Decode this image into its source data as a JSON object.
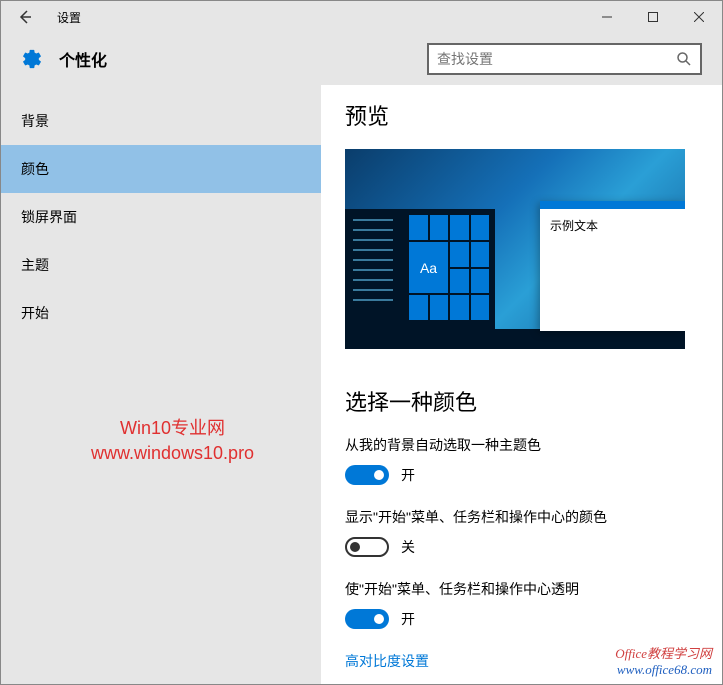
{
  "window": {
    "title": "设置"
  },
  "header": {
    "page_title": "个性化",
    "search_placeholder": "查找设置"
  },
  "sidebar": {
    "items": [
      {
        "label": "背景"
      },
      {
        "label": "颜色"
      },
      {
        "label": "锁屏界面"
      },
      {
        "label": "主题"
      },
      {
        "label": "开始"
      }
    ],
    "active_index": 1
  },
  "main": {
    "preview_heading": "预览",
    "sample_text": "示例文本",
    "tile_text": "Aa",
    "choose_color_heading": "选择一种颜色",
    "options": [
      {
        "label": "从我的背景自动选取一种主题色",
        "state": "on",
        "state_text": "开"
      },
      {
        "label": "显示\"开始\"菜单、任务栏和操作中心的颜色",
        "state": "off",
        "state_text": "关"
      },
      {
        "label": "使\"开始\"菜单、任务栏和操作中心透明",
        "state": "on",
        "state_text": "开"
      }
    ],
    "high_contrast_link": "高对比度设置"
  },
  "watermarks": {
    "w1_line1": "Win10专业网",
    "w1_line2": "www.windows10.pro",
    "w2_line1": "Office教程学习网",
    "w2_line2": "www.office68.com"
  }
}
